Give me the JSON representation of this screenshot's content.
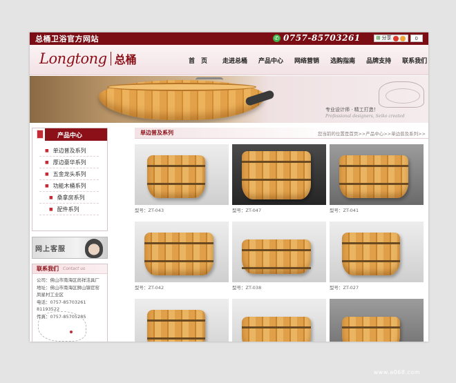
{
  "topbar": {
    "site_title": "总桶卫浴官方网站",
    "phone": "0757-85703261",
    "share_label": "分享",
    "share_count": "0"
  },
  "header": {
    "logo_en": "Longtong",
    "logo_cn": "总桶",
    "nav": [
      "首　页",
      "走进总桶",
      "产品中心",
      "网络营销",
      "选购指南",
      "品牌支持",
      "联系我们"
    ]
  },
  "banner": {
    "slogan": "专业设计师 · 精工打造！",
    "slogan_en": "Professional designers, Seiko created"
  },
  "sidebar": {
    "category_title": "产品中心",
    "categories": [
      "单边普及系列",
      "厚边豪华系列",
      "五金龙头系列",
      "功能木桶系列",
      "桑拿房系列",
      "配件系列"
    ],
    "service_label": "网上客服",
    "contact_title": "联系我们",
    "contact_en": "Contact us",
    "contact_lines": [
      "公司：佛山市南海区尚祥洁具厂",
      "地址：佛山市南海区狮山镇官窑",
      "凤星村工业区",
      "电话：0757-85703261 81193522",
      "传真：0757-85705285"
    ]
  },
  "main": {
    "series_title": "单边普及系列",
    "breadcrumb": "您当前的位置是首页>>产品中心>>单边普及系列>>",
    "products": [
      {
        "model": "型号：ZT-043"
      },
      {
        "model": "型号：ZT-047"
      },
      {
        "model": "型号：ZT-041"
      },
      {
        "model": "型号：ZT-042"
      },
      {
        "model": "型号：ZT-038"
      },
      {
        "model": "型号：ZT-027"
      },
      {
        "model": ""
      },
      {
        "model": ""
      },
      {
        "model": ""
      }
    ]
  },
  "watermark": "www.a068.com",
  "colors": {
    "brand": "#7a0e14",
    "accent": "#c22a35",
    "wood": "#e0a04a"
  }
}
